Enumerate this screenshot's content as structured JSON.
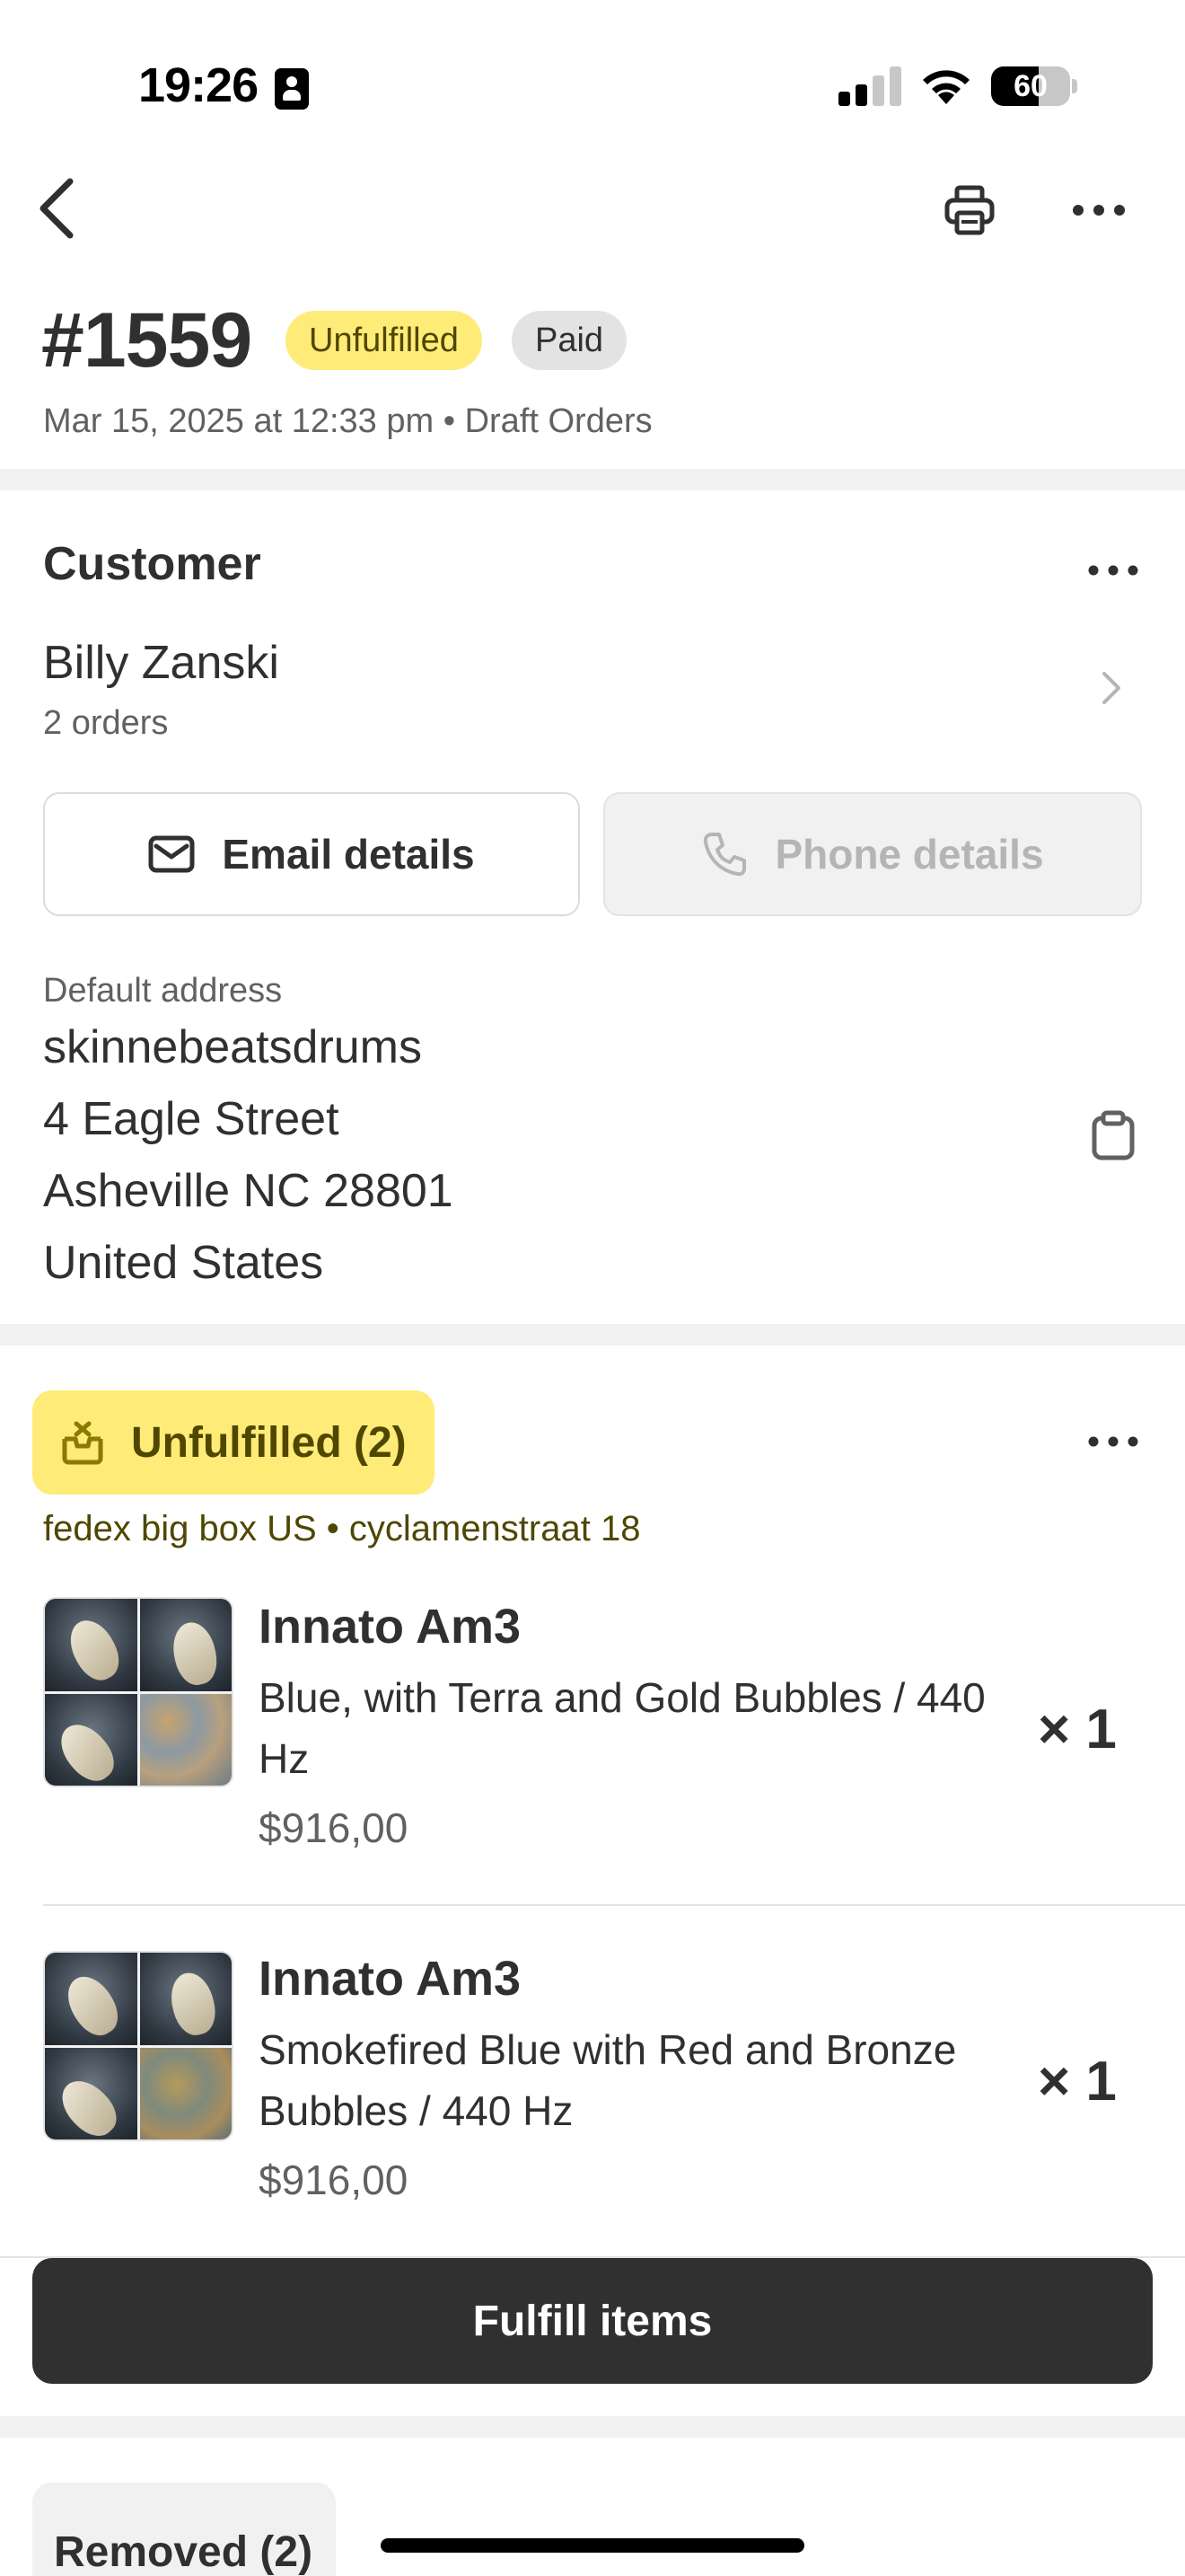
{
  "status_bar": {
    "time": "19:26",
    "battery": "60",
    "battery_level": 0.6
  },
  "header": {
    "order_number": "#1559",
    "badges": {
      "fulfillment": "Unfulfilled",
      "payment": "Paid"
    },
    "meta": "Mar 15, 2025 at 12:33 pm • Draft Orders"
  },
  "customer": {
    "heading": "Customer",
    "name": "Billy Zanski",
    "orders": "2 orders",
    "email_button": "Email details",
    "phone_button": "Phone details",
    "address_label": "Default address",
    "address_lines": [
      "skinnebeatsdrums",
      "4 Eagle Street",
      "Asheville NC 28801",
      "United States"
    ]
  },
  "fulfillment": {
    "status_label": "Unfulfilled (2)",
    "shipping": "fedex big box US • cyclamenstraat 18",
    "items": [
      {
        "title": "Innato Am3",
        "variant": "Blue, with Terra and Gold Bubbles / 440 Hz",
        "price": "$916,00",
        "qty": "× 1"
      },
      {
        "title": "Innato Am3",
        "variant": "Smokefired Blue with Red and Bronze Bubbles / 440 Hz",
        "price": "$916,00",
        "qty": "× 1"
      }
    ],
    "fulfill_button": "Fulfill items"
  },
  "removed": {
    "label": "Removed (2)"
  },
  "colors": {
    "unfulfilled_badge": "#ffeb78",
    "paid_badge": "#e3e3e3",
    "primary_button": "#303030"
  },
  "icons": [
    "back-chevron-icon",
    "printer-icon",
    "more-icon",
    "chevron-right-icon",
    "envelope-icon",
    "phone-icon",
    "clipboard-icon",
    "unfulfilled-box-icon"
  ]
}
